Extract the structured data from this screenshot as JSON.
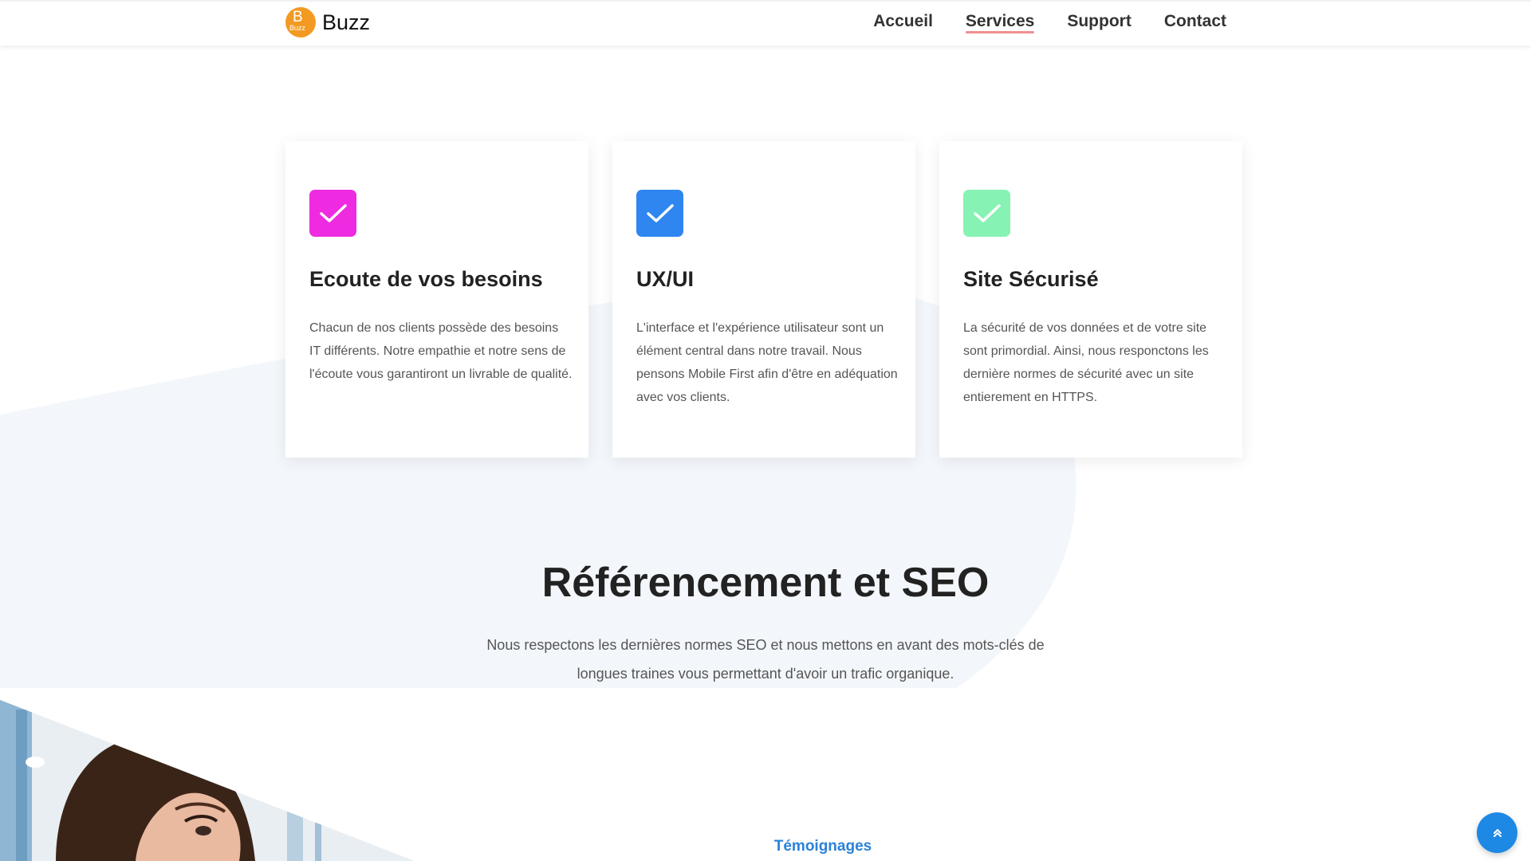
{
  "brand": {
    "logo_letter": "B",
    "logo_small": "Buzz",
    "name": "Buzz"
  },
  "nav": {
    "items": [
      {
        "label": "Accueil",
        "active": false
      },
      {
        "label": "Services",
        "active": true
      },
      {
        "label": "Support",
        "active": false
      },
      {
        "label": "Contact",
        "active": false
      }
    ]
  },
  "cards": [
    {
      "title": "Ecoute de vos besoins",
      "text": "Chacun de nos clients possède des besoins IT différents. Notre empathie et notre sens de l'écoute vous garantiront un livrable de qualité.",
      "icon": "check-icon",
      "color": "#ee2be0"
    },
    {
      "title": "UX/UI",
      "text": "L'interface et l'expérience utilisateur sont un élément central dans notre travail. Nous pensons Mobile First afin d'être en adéquation avec vos clients.",
      "icon": "check-icon",
      "color": "#2f86f0"
    },
    {
      "title": "Site Sécurisé",
      "text": "La sécurité de vos données et de votre site sont primordial. Ainsi, nous responctons les dernière normes de sécurité avec un site entierement en HTTPS.",
      "icon": "check-icon",
      "color": "#86f2b3"
    }
  ],
  "seo": {
    "title": "Référencement et SEO",
    "text": "Nous respectons les dernières normes SEO et nous mettons en avant des mots-clés de longues traines vous permettant d'avoir un trafic organique."
  },
  "testimonials": {
    "label": "Témoignages"
  },
  "scroll_top": {
    "icon": "double-chevron-up-icon"
  }
}
